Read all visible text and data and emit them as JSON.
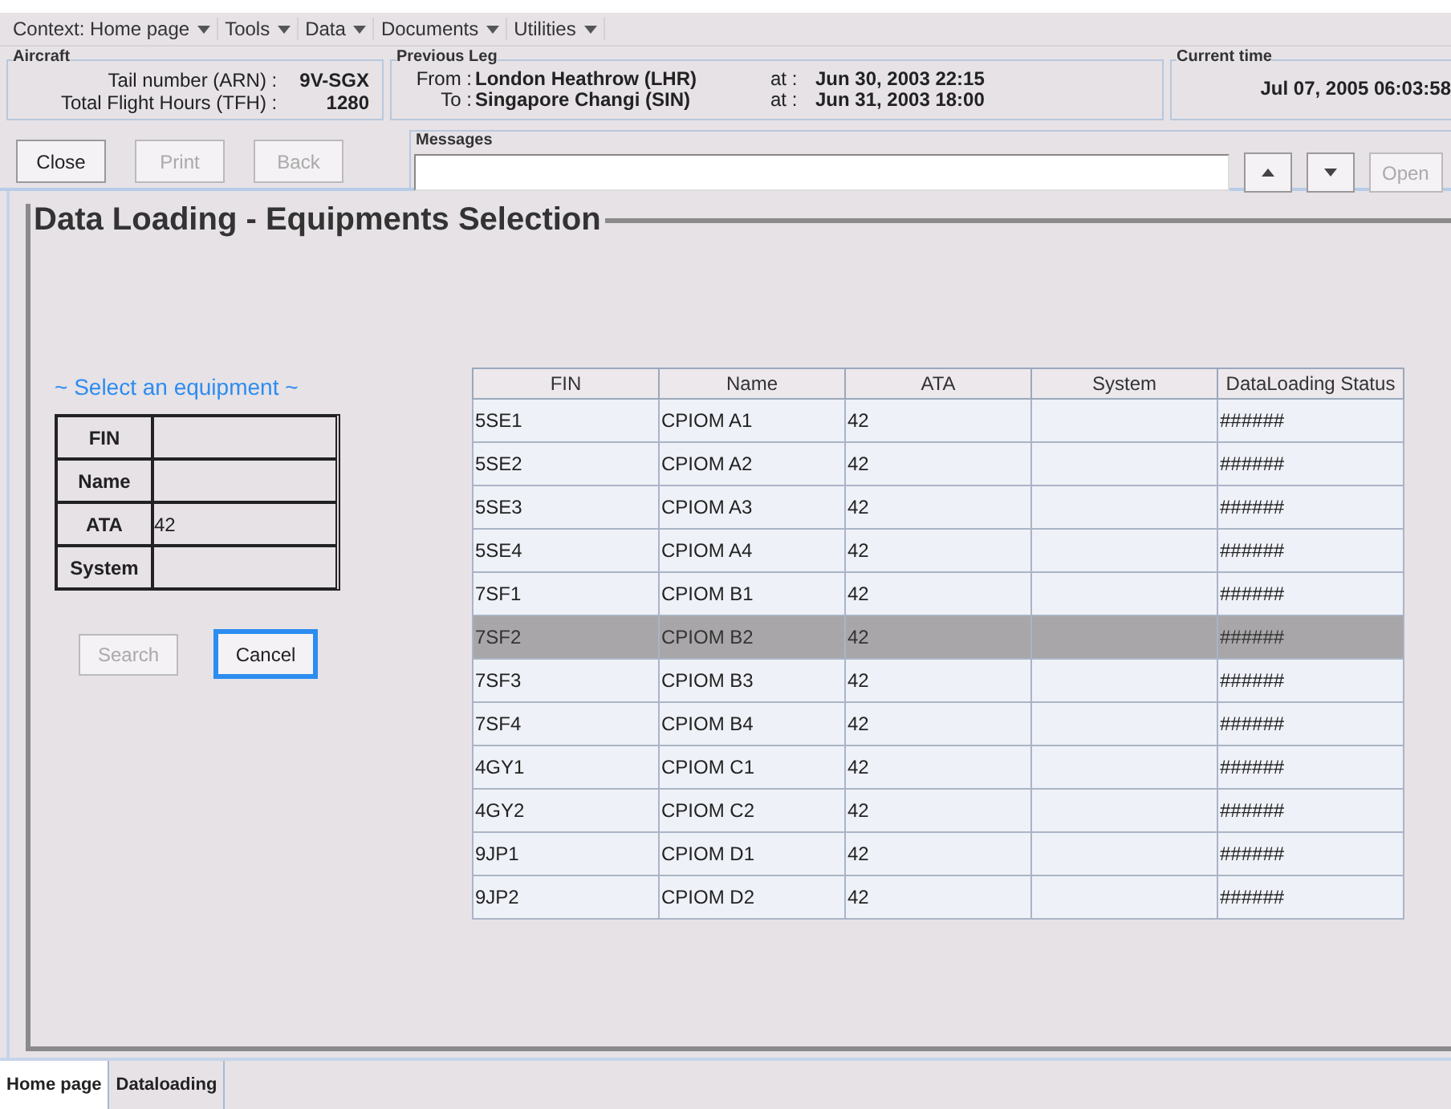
{
  "menu": [
    {
      "label": "Context: Home page"
    },
    {
      "label": "Tools"
    },
    {
      "label": "Data"
    },
    {
      "label": "Documents"
    },
    {
      "label": "Utilities"
    }
  ],
  "aircraft": {
    "title": "Aircraft",
    "fields": [
      {
        "label": "Tail number (ARN) :",
        "value": "9V-SGX"
      },
      {
        "label": "Total Flight Hours (TFH) :",
        "value": "1280"
      }
    ]
  },
  "previous_leg": {
    "title": "Previous Leg",
    "rows": [
      {
        "label": "From :",
        "place": "London Heathrow (LHR)",
        "at": "at :",
        "time": "Jun 30, 2003 22:15"
      },
      {
        "label": "To :",
        "place": "Singapore Changi (SIN)",
        "at": "at :",
        "time": "Jun 31, 2003 18:00"
      }
    ]
  },
  "current_time": {
    "title": "Current time",
    "value": "Jul 07, 2005 06:03:58"
  },
  "buttons": [
    {
      "label": "Close",
      "disabled": false
    },
    {
      "label": "Print",
      "disabled": true
    },
    {
      "label": "Back",
      "disabled": true
    }
  ],
  "messages": {
    "title": "Messages",
    "open": {
      "label": "Open",
      "disabled": true
    }
  },
  "panel": {
    "title": "Data Loading - Equipments Selection"
  },
  "form": {
    "title": "~ Select an equipment ~",
    "fields": [
      {
        "label": "FIN"
      },
      {
        "label": "Name"
      },
      {
        "label": "ATA",
        "value": "42"
      },
      {
        "label": "System"
      }
    ],
    "buttons": [
      {
        "label": "Search",
        "disabled": true,
        "focused": false
      },
      {
        "label": "Cancel",
        "disabled": false,
        "focused": true
      }
    ]
  },
  "table": {
    "columns": [
      "FIN",
      "Name",
      "ATA",
      "System",
      "DataLoading Status"
    ],
    "rows": [
      {
        "cells": [
          "5SE1",
          "CPIOM A1",
          "42",
          "",
          "######"
        ],
        "selected": false
      },
      {
        "cells": [
          "5SE2",
          "CPIOM A2",
          "42",
          "",
          "######"
        ],
        "selected": false
      },
      {
        "cells": [
          "5SE3",
          "CPIOM A3",
          "42",
          "",
          "######"
        ],
        "selected": false
      },
      {
        "cells": [
          "5SE4",
          "CPIOM A4",
          "42",
          "",
          "######"
        ],
        "selected": false
      },
      {
        "cells": [
          "7SF1",
          "CPIOM B1",
          "42",
          "",
          "######"
        ],
        "selected": false
      },
      {
        "cells": [
          "7SF2",
          "CPIOM B2",
          "42",
          "",
          "######"
        ],
        "selected": true
      },
      {
        "cells": [
          "7SF3",
          "CPIOM B3",
          "42",
          "",
          "######"
        ],
        "selected": false
      },
      {
        "cells": [
          "7SF4",
          "CPIOM B4",
          "42",
          "",
          "######"
        ],
        "selected": false
      },
      {
        "cells": [
          "4GY1",
          "CPIOM C1",
          "42",
          "",
          "######"
        ],
        "selected": false
      },
      {
        "cells": [
          "4GY2",
          "CPIOM C2",
          "42",
          "",
          "######"
        ],
        "selected": false
      },
      {
        "cells": [
          "9JP1",
          "CPIOM D1",
          "42",
          "",
          "######"
        ],
        "selected": false
      },
      {
        "cells": [
          "9JP2",
          "CPIOM D2",
          "42",
          "",
          "######"
        ],
        "selected": false
      }
    ]
  },
  "tabs": [
    {
      "label": "Home page",
      "selected": true
    },
    {
      "label": "Dataloading",
      "selected": false
    }
  ]
}
